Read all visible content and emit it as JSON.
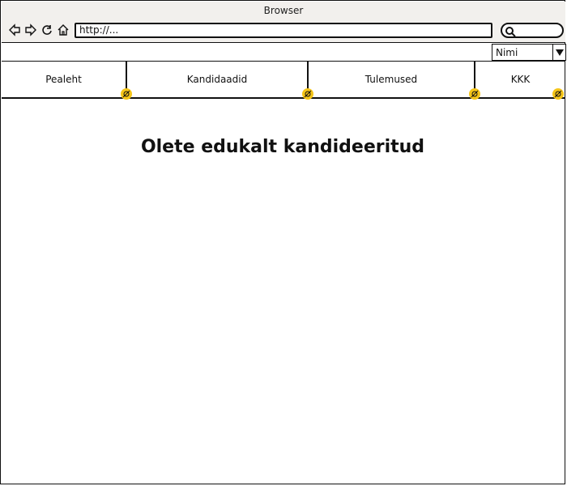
{
  "window": {
    "title": "Browser"
  },
  "address_bar": {
    "value": "http://..."
  },
  "language_select": {
    "value": "Nimi"
  },
  "tabs": [
    {
      "label": "Pealeht"
    },
    {
      "label": "Kandidaadid"
    },
    {
      "label": "Tulemused"
    },
    {
      "label": "KKK"
    }
  ],
  "main": {
    "heading": "Olete edukalt kandideeritud"
  },
  "icons": {
    "back": "arrow-left-icon",
    "forward": "arrow-right-icon",
    "reload": "reload-icon",
    "home": "home-icon",
    "search": "search-icon",
    "dropdown": "dropdown-arrow-icon",
    "link": "link-icon"
  },
  "colors": {
    "link_badge": "#f5c518",
    "chrome_bg": "#f2f0ed"
  }
}
